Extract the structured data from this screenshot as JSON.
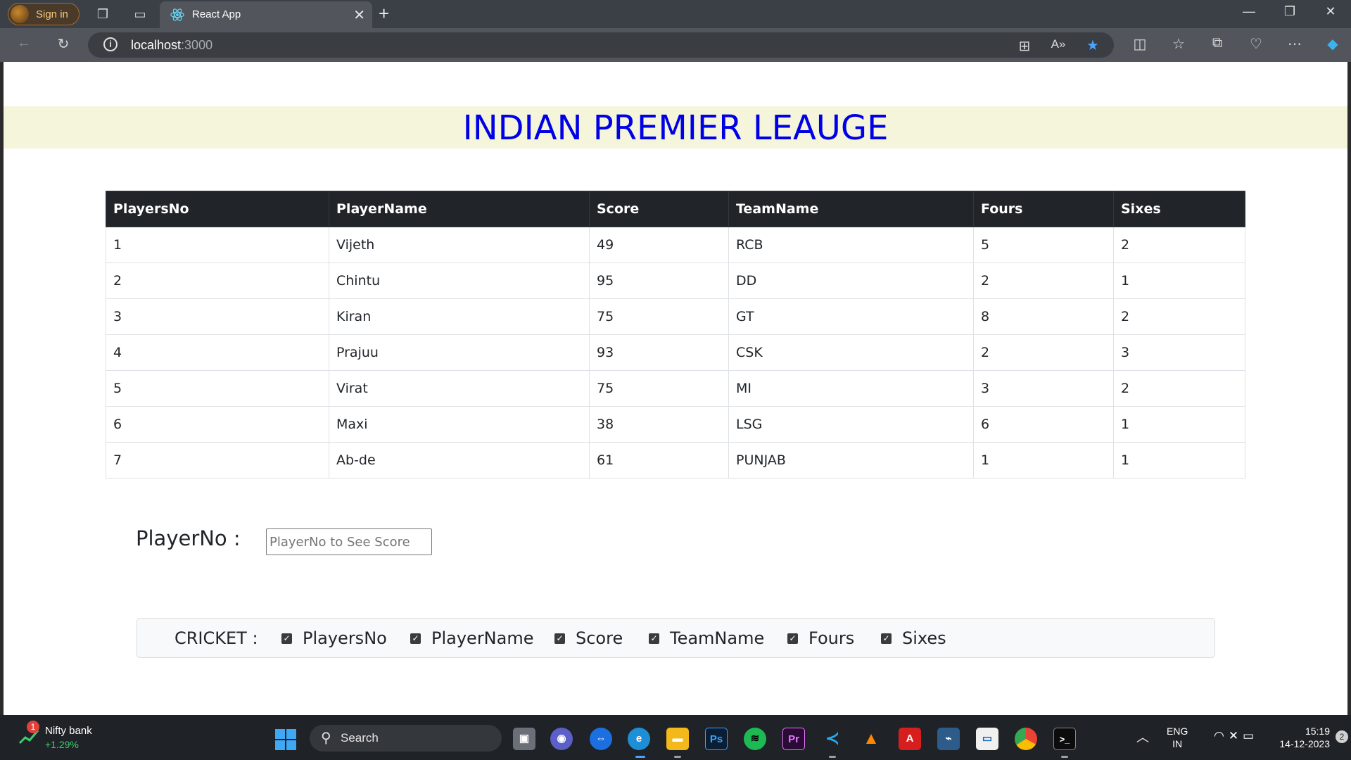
{
  "browser": {
    "signin_label": "Sign in",
    "tab_title": "React App",
    "url_host": "localhost",
    "url_port": ":3000"
  },
  "page": {
    "heading": "INDIAN PREMIER LEAUGE",
    "table": {
      "headers": [
        "PlayersNo",
        "PlayerName",
        "Score",
        "TeamName",
        "Fours",
        "Sixes"
      ],
      "rows": [
        [
          "1",
          "Vijeth",
          "49",
          "RCB",
          "5",
          "2"
        ],
        [
          "2",
          "Chintu",
          "95",
          "DD",
          "2",
          "1"
        ],
        [
          "3",
          "Kiran",
          "75",
          "GT",
          "8",
          "2"
        ],
        [
          "4",
          "Prajuu",
          "93",
          "CSK",
          "2",
          "3"
        ],
        [
          "5",
          "Virat",
          "75",
          "MI",
          "3",
          "2"
        ],
        [
          "6",
          "Maxi",
          "38",
          "LSG",
          "6",
          "1"
        ],
        [
          "7",
          "Ab-de",
          "61",
          "PUNJAB",
          "1",
          "1"
        ]
      ]
    },
    "lookup": {
      "label": "PlayerNo :",
      "placeholder": "PlayerNo to See Score",
      "value": ""
    },
    "filter": {
      "label": "CRICKET :",
      "options": [
        {
          "label": "PlayersNo",
          "checked": true
        },
        {
          "label": "PlayerName",
          "checked": true
        },
        {
          "label": "Score",
          "checked": true
        },
        {
          "label": "TeamName",
          "checked": true
        },
        {
          "label": "Fours",
          "checked": true
        },
        {
          "label": "Sixes",
          "checked": true
        }
      ]
    }
  },
  "taskbar": {
    "widget_badge": "1",
    "widget_name": "Nifty bank",
    "widget_change": "+1.29%",
    "search_label": "Search",
    "lang_line1": "ENG",
    "lang_line2": "IN",
    "time": "15:19",
    "date": "14-12-2023",
    "notification_count": "2"
  }
}
